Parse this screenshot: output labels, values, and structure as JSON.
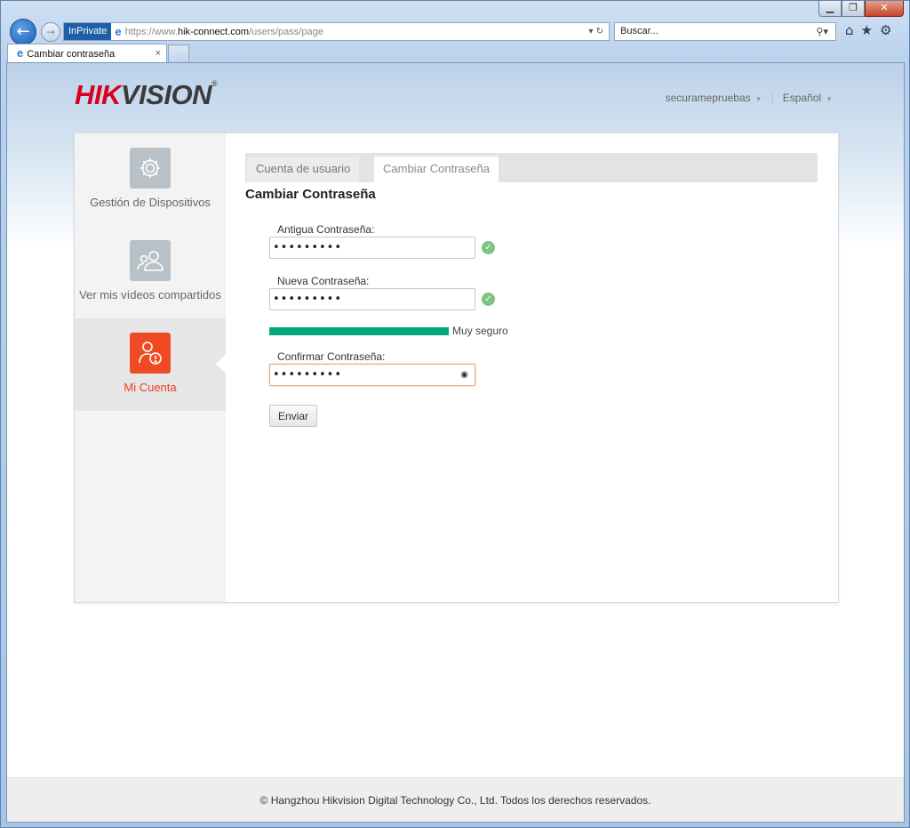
{
  "browser": {
    "inprivate": "InPrivate",
    "url_prefix": "https://www.",
    "url_host": "hik-connect.com",
    "url_path": "/users/pass/page",
    "search_placeholder": "Buscar...",
    "tab_title": "Cambiar contraseña",
    "tab_close": "×"
  },
  "header": {
    "logo_hik": "HIK",
    "logo_vision": "VISION",
    "logo_reg": "®",
    "user": "securamepruebas",
    "language": "Español"
  },
  "sidebar": {
    "items": [
      {
        "label": "Gestión de Dispositivos",
        "icon": "gear-icon"
      },
      {
        "label": "Ver mis vídeos compartidos",
        "icon": "users-icon"
      },
      {
        "label": "Mi Cuenta",
        "icon": "account-alert-icon",
        "active": true
      }
    ]
  },
  "tabs": {
    "user_account": "Cuenta de usuario",
    "change_password": "Cambiar Contraseña"
  },
  "form": {
    "title": "Cambiar Contraseña",
    "old_label": "Antigua Contraseña:",
    "old_value": "•••••••••",
    "new_label": "Nueva Contraseña:",
    "new_value": "•••••••••",
    "strength_label": "Muy seguro",
    "confirm_label": "Confirmar Contraseña:",
    "confirm_value": "•••••••••",
    "submit": "Enviar"
  },
  "footer": {
    "copyright": "© Hangzhou Hikvision Digital Technology Co., Ltd. Todos los derechos reservados."
  },
  "colors": {
    "brand_red": "#d7001f",
    "active_orange": "#f04a24",
    "strength_green": "#00a97a",
    "check_green": "#7dc47f"
  }
}
